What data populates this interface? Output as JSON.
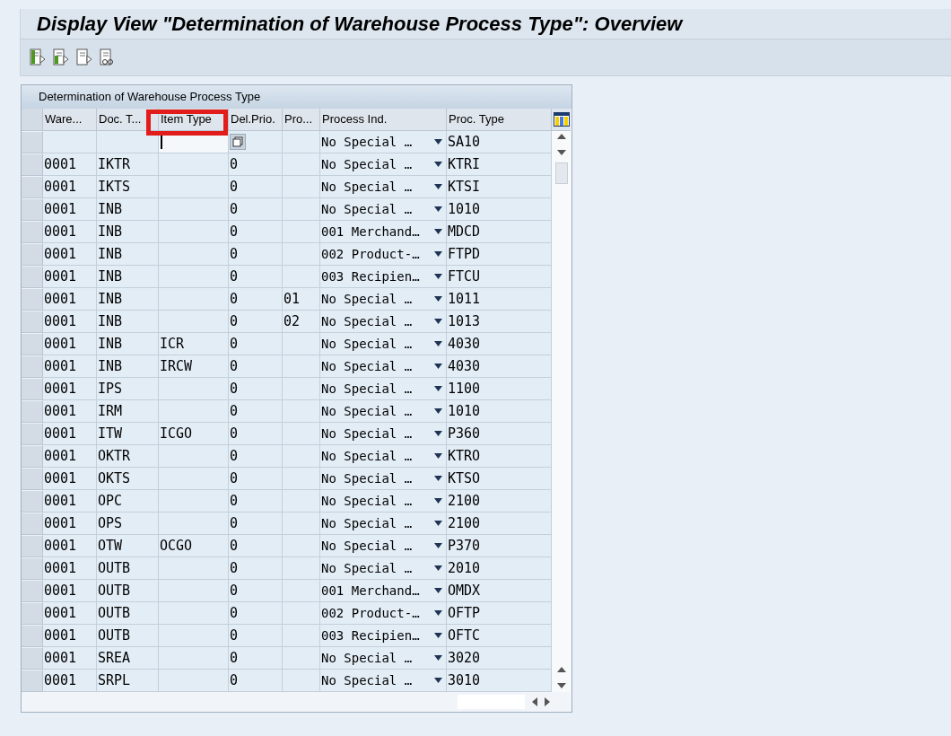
{
  "window": {
    "title": "Display View \"Determination of Warehouse Process Type\": Overview"
  },
  "table": {
    "title": "Determination of Warehouse Process Type",
    "columns": [
      "Ware...",
      "Doc. T...",
      "Item Type",
      "Del.Prio.",
      "Pro...",
      "Process Ind.",
      "Proc. Type"
    ],
    "rows": [
      {
        "cells": [
          "",
          "",
          "",
          "",
          "",
          "No Special …",
          "SA10"
        ],
        "focused": true
      },
      {
        "cells": [
          "0001",
          "IKTR",
          "",
          "0",
          "",
          "No Special …",
          "KTRI"
        ],
        "focused": false
      },
      {
        "cells": [
          "0001",
          "IKTS",
          "",
          "0",
          "",
          "No Special …",
          "KTSI"
        ],
        "focused": false
      },
      {
        "cells": [
          "0001",
          "INB",
          "",
          "0",
          "",
          "No Special …",
          "1010"
        ],
        "focused": false
      },
      {
        "cells": [
          "0001",
          "INB",
          "",
          "0",
          "",
          "001 Merchand…",
          "MDCD"
        ],
        "focused": false
      },
      {
        "cells": [
          "0001",
          "INB",
          "",
          "0",
          "",
          "002 Product-…",
          "FTPD"
        ],
        "focused": false
      },
      {
        "cells": [
          "0001",
          "INB",
          "",
          "0",
          "",
          "003 Recipien…",
          "FTCU"
        ],
        "focused": false
      },
      {
        "cells": [
          "0001",
          "INB",
          "",
          "0",
          "01",
          "No Special …",
          "1011"
        ],
        "focused": false
      },
      {
        "cells": [
          "0001",
          "INB",
          "",
          "0",
          "02",
          "No Special …",
          "1013"
        ],
        "focused": false
      },
      {
        "cells": [
          "0001",
          "INB",
          "ICR",
          "0",
          "",
          "No Special …",
          "4030"
        ],
        "focused": false
      },
      {
        "cells": [
          "0001",
          "INB",
          "IRCW",
          "0",
          "",
          "No Special …",
          "4030"
        ],
        "focused": false
      },
      {
        "cells": [
          "0001",
          "IPS",
          "",
          "0",
          "",
          "No Special …",
          "1100"
        ],
        "focused": false
      },
      {
        "cells": [
          "0001",
          "IRM",
          "",
          "0",
          "",
          "No Special …",
          "1010"
        ],
        "focused": false
      },
      {
        "cells": [
          "0001",
          "ITW",
          "ICGO",
          "0",
          "",
          "No Special …",
          "P360"
        ],
        "focused": false
      },
      {
        "cells": [
          "0001",
          "OKTR",
          "",
          "0",
          "",
          "No Special …",
          "KTRO"
        ],
        "focused": false
      },
      {
        "cells": [
          "0001",
          "OKTS",
          "",
          "0",
          "",
          "No Special …",
          "KTSO"
        ],
        "focused": false
      },
      {
        "cells": [
          "0001",
          "OPC",
          "",
          "0",
          "",
          "No Special …",
          "2100"
        ],
        "focused": false
      },
      {
        "cells": [
          "0001",
          "OPS",
          "",
          "0",
          "",
          "No Special …",
          "2100"
        ],
        "focused": false
      },
      {
        "cells": [
          "0001",
          "OTW",
          "OCGO",
          "0",
          "",
          "No Special …",
          "P370"
        ],
        "focused": false
      },
      {
        "cells": [
          "0001",
          "OUTB",
          "",
          "0",
          "",
          "No Special …",
          "2010"
        ],
        "focused": false
      },
      {
        "cells": [
          "0001",
          "OUTB",
          "",
          "0",
          "",
          "001 Merchand…",
          "OMDX"
        ],
        "focused": false
      },
      {
        "cells": [
          "0001",
          "OUTB",
          "",
          "0",
          "",
          "002 Product-…",
          "OFTP"
        ],
        "focused": false
      },
      {
        "cells": [
          "0001",
          "OUTB",
          "",
          "0",
          "",
          "003 Recipien…",
          "OFTC"
        ],
        "focused": false
      },
      {
        "cells": [
          "0001",
          "SREA",
          "",
          "0",
          "",
          "No Special …",
          "3020"
        ],
        "focused": false
      },
      {
        "cells": [
          "0001",
          "SRPL",
          "",
          "0",
          "",
          "No Special …",
          "3010"
        ],
        "focused": false
      }
    ]
  }
}
